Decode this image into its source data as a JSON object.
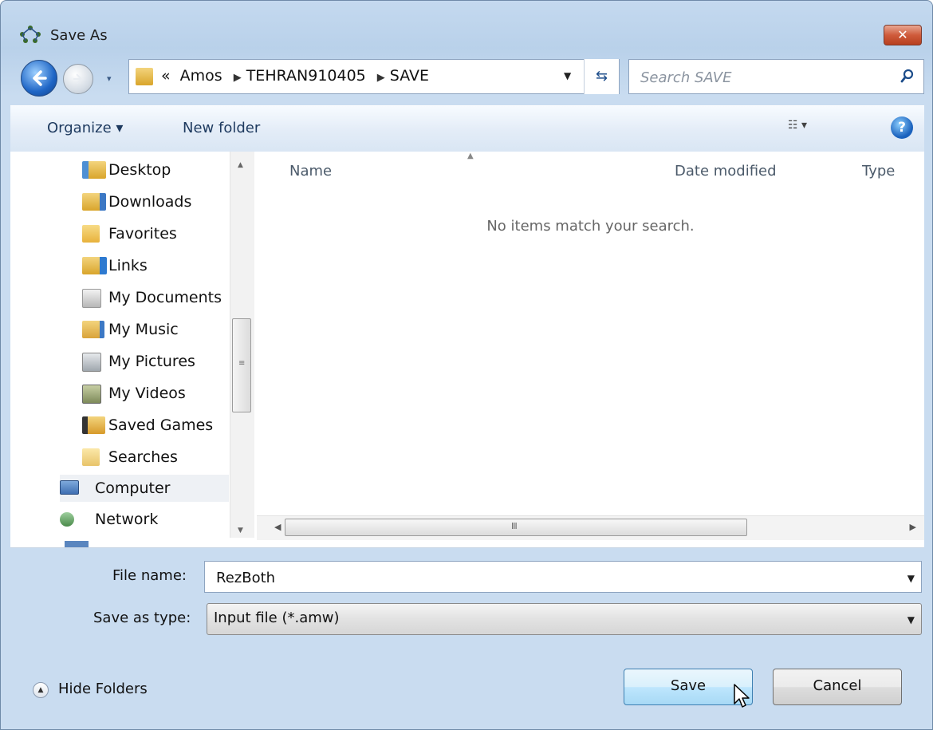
{
  "window": {
    "title": "Save As",
    "close_label": "✕"
  },
  "nav": {
    "recent_glyph": "▾",
    "breadcrumb_overflow": "«",
    "breadcrumbs": [
      "Amos",
      "TEHRAN910405",
      "SAVE"
    ],
    "search_placeholder": "Search SAVE"
  },
  "toolbar": {
    "organize_label": "Organize ▾",
    "new_folder_label": "New folder",
    "view_label": "☷ ▾",
    "help_label": "?"
  },
  "sidebar": {
    "items": [
      {
        "label": "Desktop",
        "icon": "desktop-folder-icon",
        "color": "#4d8fd4"
      },
      {
        "label": "Downloads",
        "icon": "downloads-folder-icon",
        "color": "#3c78c4"
      },
      {
        "label": "Favorites",
        "icon": "favorites-folder-icon",
        "color": "#e8b23c"
      },
      {
        "label": "Links",
        "icon": "links-folder-icon",
        "color": "#2e7ad0"
      },
      {
        "label": "My Documents",
        "icon": "documents-folder-icon",
        "color": "#b7b7b7"
      },
      {
        "label": "My Music",
        "icon": "music-folder-icon",
        "color": "#d9a33a"
      },
      {
        "label": "My Pictures",
        "icon": "pictures-folder-icon",
        "color": "#9fa6ad"
      },
      {
        "label": "My Videos",
        "icon": "videos-folder-icon",
        "color": "#7e8a5a"
      },
      {
        "label": "Saved Games",
        "icon": "saved-games-folder-icon",
        "color": "#d79a2a"
      },
      {
        "label": "Searches",
        "icon": "searches-folder-icon",
        "color": "#e8c46a"
      },
      {
        "label": "Computer",
        "icon": "computer-icon",
        "color": "#3f6fb2"
      },
      {
        "label": "Network",
        "icon": "network-icon",
        "color": "#4a8a4a"
      }
    ],
    "scroll_grip": "≡"
  },
  "file_list": {
    "columns": [
      "Name",
      "Date modified",
      "Type"
    ],
    "empty_message": "No items match your search.",
    "hscroll_grip": "III"
  },
  "form": {
    "file_name_label": "File name:",
    "file_name_value": "RezBoth",
    "save_type_label": "Save as type:",
    "save_type_value": "Input file (*.amw)"
  },
  "footer": {
    "hide_folders_label": "Hide Folders",
    "save_label": "Save",
    "cancel_label": "Cancel"
  },
  "colors": {
    "window_bg": "#c4d9ef",
    "close_button": "#cf5b3b",
    "save_button": "#bee6fd"
  }
}
